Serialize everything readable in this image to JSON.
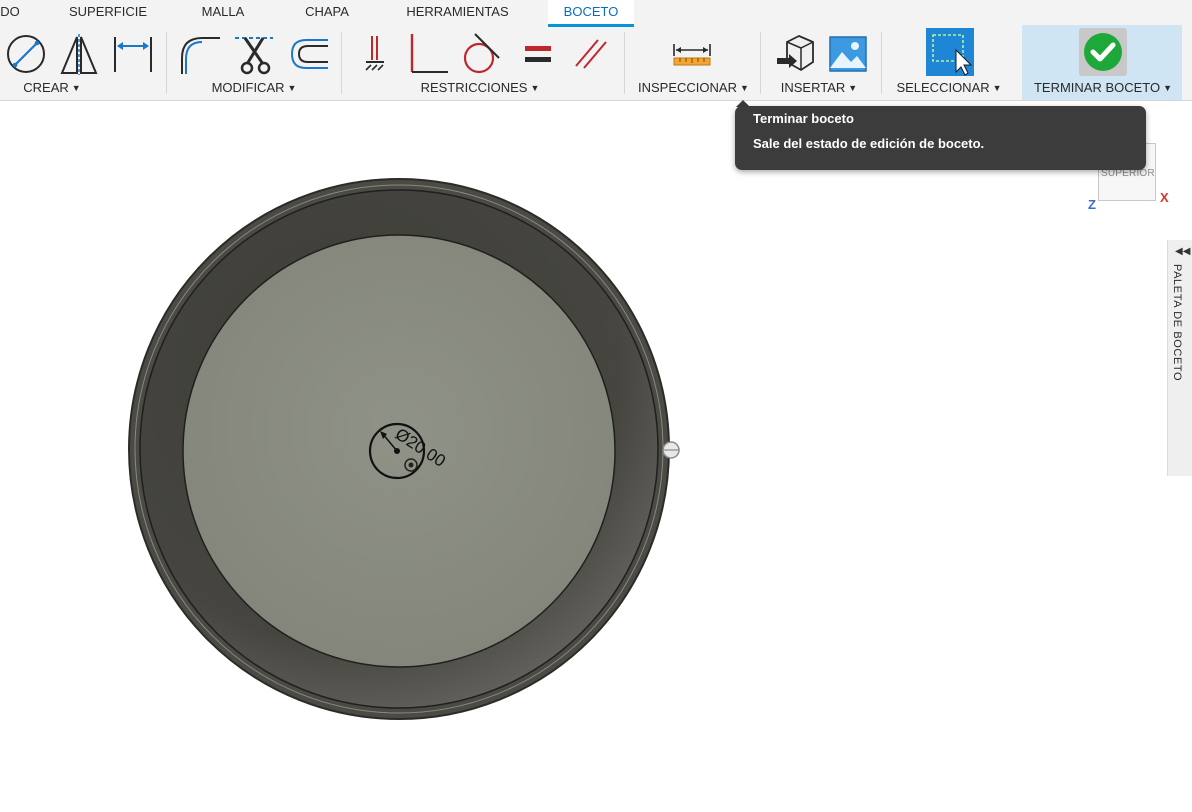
{
  "tabs": [
    {
      "label": "DO",
      "active": false
    },
    {
      "label": "SUPERFICIE",
      "active": false
    },
    {
      "label": "MALLA",
      "active": false
    },
    {
      "label": "CHAPA",
      "active": false
    },
    {
      "label": "HERRAMIENTAS",
      "active": false
    },
    {
      "label": "BOCETO",
      "active": true
    }
  ],
  "ribbon": {
    "groups": {
      "create": "CREAR",
      "modify": "MODIFICAR",
      "constraints": "RESTRICCIONES",
      "inspect": "INSPECCIONAR",
      "insert": "INSERTAR",
      "select": "SELECCIONAR",
      "finish": "TERMINAR BOCETO"
    },
    "icons": {
      "create": [
        "circle-diameter-icon",
        "mirror-triangle-icon",
        "sketch-dimension-icon"
      ],
      "modify": [
        "fillet-icon",
        "trim-scissors-icon",
        "offset-icon"
      ],
      "constraints": [
        "fix-constraint-icon",
        "perpendicular-icon",
        "tangent-icon",
        "equal-icon",
        "parallel-icon"
      ],
      "inspect": [
        "measure-ruler-icon"
      ],
      "insert": [
        "insert-derive-icon",
        "insert-image-icon"
      ],
      "select": [
        "select-window-icon"
      ],
      "finish": [
        "green-check-icon"
      ]
    }
  },
  "tooltip": {
    "title": "Terminar boceto",
    "body": "Sale del estado de edición de boceto."
  },
  "viewcube": {
    "face": "SUPERIOR",
    "axis_x": "X",
    "axis_z": "Z"
  },
  "palette": {
    "label": "PALETA DE BOCETO",
    "chevron": "◀◀"
  },
  "dimension": {
    "text": "Ø20.00"
  },
  "colors": {
    "accent": "#0696d7",
    "finish_bg": "#cfe5f3",
    "rim_dark": "#4b4a45",
    "inner_face": "#8c8e84",
    "tooltip_bg": "#3c3c3c",
    "constraint_red": "#c0272d",
    "check_green": "#1fa83a"
  }
}
